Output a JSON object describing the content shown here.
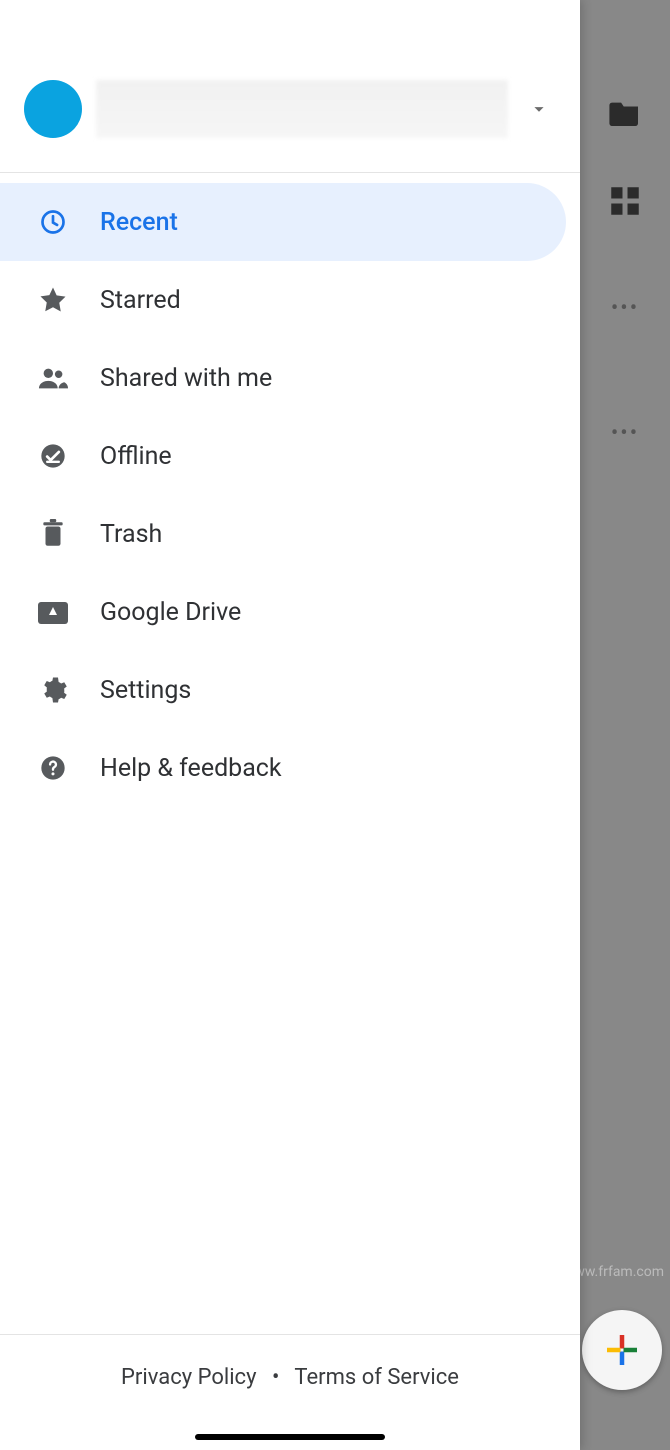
{
  "menu": {
    "items": [
      {
        "key": "recent",
        "label": "Recent",
        "icon": "clock-icon",
        "active": true
      },
      {
        "key": "starred",
        "label": "Starred",
        "icon": "star-icon",
        "active": false
      },
      {
        "key": "shared",
        "label": "Shared with me",
        "icon": "people-icon",
        "active": false
      },
      {
        "key": "offline",
        "label": "Offline",
        "icon": "offline-icon",
        "active": false
      },
      {
        "key": "trash",
        "label": "Trash",
        "icon": "trash-icon",
        "active": false
      },
      {
        "key": "drive",
        "label": "Google Drive",
        "icon": "drive-icon",
        "active": false
      },
      {
        "key": "settings",
        "label": "Settings",
        "icon": "gear-icon",
        "active": false
      },
      {
        "key": "help",
        "label": "Help & feedback",
        "icon": "help-icon",
        "active": false
      }
    ]
  },
  "footer": {
    "privacy": "Privacy Policy",
    "separator": "•",
    "terms": "Terms of Service"
  },
  "watermark": "www.frfam.com",
  "colors": {
    "accent": "#1a73e8",
    "avatar": "#0aa3e0",
    "active_bg": "#e7f0fe"
  }
}
